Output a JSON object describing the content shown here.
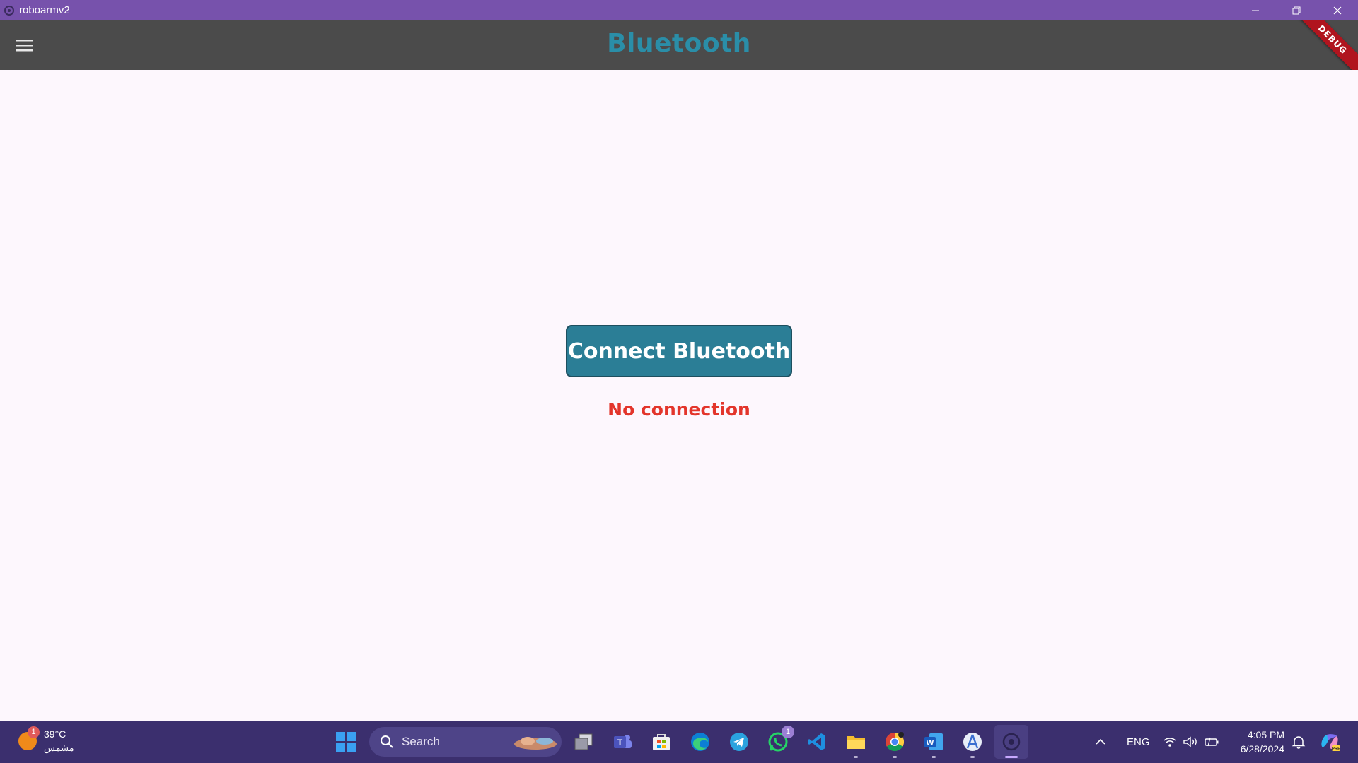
{
  "window": {
    "title": "roboarmv2",
    "controls": [
      "minimize-icon",
      "restore-icon",
      "close-icon"
    ]
  },
  "appbar": {
    "menu_icon": "hamburger-menu-icon",
    "title": "Bluetooth",
    "debug_banner": "DEBUG"
  },
  "main": {
    "connect_button_label": "Connect Bluetooth",
    "status_text": "No connection",
    "colors": {
      "button": "#2b7e96",
      "status": "#e3352b",
      "title": "#2a8ea8"
    }
  },
  "taskbar": {
    "weather": {
      "badge": "1",
      "temperature": "39°C",
      "description": "مشمس"
    },
    "search": {
      "placeholder": "Search"
    },
    "pinned_apps": [
      {
        "name": "start-icon"
      },
      {
        "name": "task-view-icon"
      },
      {
        "name": "teams-icon"
      },
      {
        "name": "microsoft-store-icon"
      },
      {
        "name": "edge-icon"
      },
      {
        "name": "telegram-icon"
      },
      {
        "name": "whatsapp-icon",
        "badge": "1"
      },
      {
        "name": "vscode-icon"
      },
      {
        "name": "file-explorer-icon"
      },
      {
        "name": "chrome-icon"
      },
      {
        "name": "word-icon"
      },
      {
        "name": "android-studio-icon"
      },
      {
        "name": "roboarmv2-app-icon"
      }
    ],
    "tray": {
      "language": "ENG",
      "time": "4:05 PM",
      "date": "6/28/2024"
    }
  }
}
